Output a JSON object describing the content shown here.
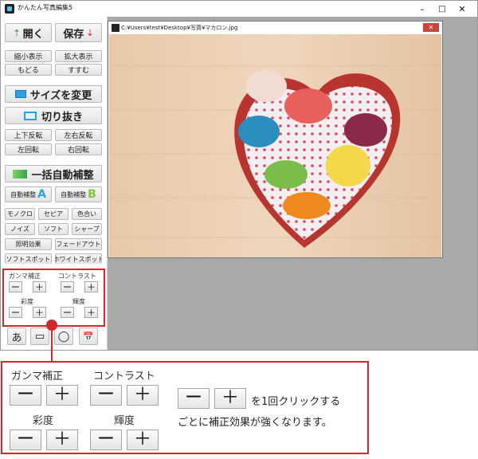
{
  "window": {
    "title": "かんたん写真編集5",
    "controls": {
      "minimize": "–",
      "maximize": "□",
      "close": "✕"
    }
  },
  "toolbar": {
    "open_label": "開く",
    "save_label": "保存",
    "zoom_out_label": "縮小表示",
    "zoom_in_label": "拡大表示",
    "undo_label": "もどる",
    "redo_label": "すすむ",
    "resize_label": "サイズを変更",
    "crop_label": "切り抜き",
    "flip_v_label": "上下反転",
    "flip_h_label": "左右反転",
    "rotate_left_label": "左回転",
    "rotate_right_label": "右回転",
    "auto_all_label": "一括自動補整",
    "auto_a_label": "自動補整",
    "auto_a_letter": "A",
    "auto_b_label": "自動補整",
    "auto_b_letter": "B",
    "filters": [
      "モノクロ",
      "セピア",
      "色合い",
      "ノイズ",
      "ソフト",
      "シャープ",
      "照明効果",
      "フェードアウト",
      "ソフトスポット",
      "ホワイトスポット"
    ]
  },
  "adjust": {
    "gamma_label": "ガンマ補正",
    "contrast_label": "コントラスト",
    "saturation_label": "彩度",
    "brightness_label": "輝度",
    "minus": "ー",
    "plus": "＋"
  },
  "bottom_tools": [
    "あ",
    "▭",
    "◯",
    "📅"
  ],
  "image_window": {
    "path": "C:¥Users¥test¥Desktop¥写真¥マカロン.jpg",
    "close": "✕"
  },
  "callout": {
    "gamma_label": "ガンマ補正",
    "contrast_label": "コントラスト",
    "saturation_label": "彩度",
    "brightness_label": "輝度",
    "minus": "ー",
    "plus": "＋",
    "line1": "を1回クリックする",
    "line2": "ごとに補正効果が強くなります。"
  },
  "colors": {
    "accent_red": "#d9232d",
    "accent_blue": "#2f9fe0",
    "accent_green": "#3aa34a"
  }
}
